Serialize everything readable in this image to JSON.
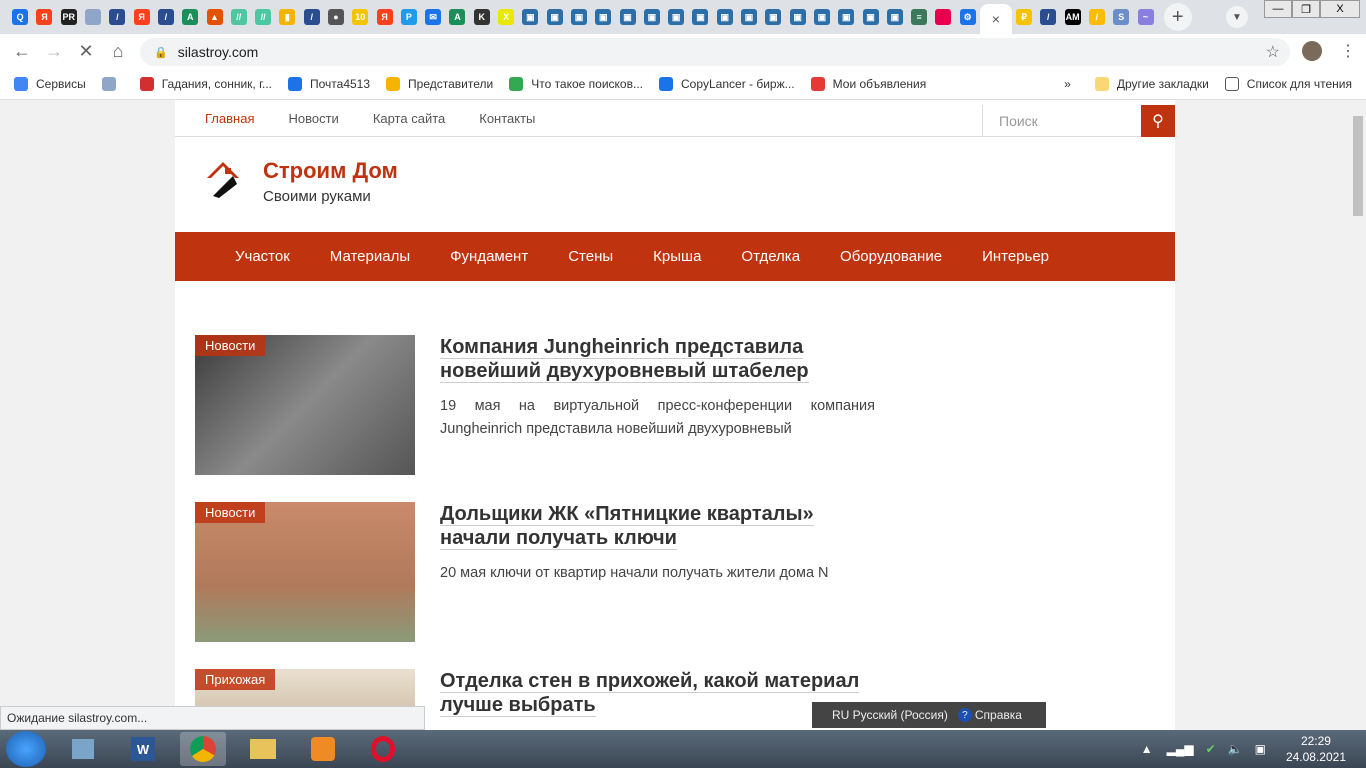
{
  "browser": {
    "tabs": [
      {
        "icon": "search-icon",
        "color": "#1a73e8",
        "glyph": "Q"
      },
      {
        "icon": "yandex-icon",
        "color": "#fc3f1d",
        "glyph": "Я"
      },
      {
        "icon": "pr-icon",
        "color": "#222",
        "glyph": "PR"
      },
      {
        "icon": "blocks-icon",
        "color": "#8fa6c9",
        "glyph": ""
      },
      {
        "icon": "stripes-icon",
        "color": "#2a4d8f",
        "glyph": "/"
      },
      {
        "icon": "yandex-icon",
        "color": "#fc3f1d",
        "glyph": "Я"
      },
      {
        "icon": "stripes-icon",
        "color": "#2a4d8f",
        "glyph": "/"
      },
      {
        "icon": "a-icon",
        "color": "#1b8e5a",
        "glyph": "A"
      },
      {
        "icon": "triangle-icon",
        "color": "#e65100",
        "glyph": "▲"
      },
      {
        "icon": "slash-icon",
        "color": "#4dc7a0",
        "glyph": "//"
      },
      {
        "icon": "slash-icon",
        "color": "#4dc7a0",
        "glyph": "//"
      },
      {
        "icon": "chart-icon",
        "color": "#f4b400",
        "glyph": "▮"
      },
      {
        "icon": "stripes-icon",
        "color": "#2a4d8f",
        "glyph": "/"
      },
      {
        "icon": "globe-icon",
        "color": "#555",
        "glyph": "●"
      },
      {
        "icon": "ten-icon",
        "color": "#f5c400",
        "glyph": "10"
      },
      {
        "icon": "yandex-icon",
        "color": "#fc3f1d",
        "glyph": "Я"
      },
      {
        "icon": "p-icon",
        "color": "#1e9be9",
        "glyph": "P"
      },
      {
        "icon": "mail-icon",
        "color": "#1a73e8",
        "glyph": "✉"
      },
      {
        "icon": "a-icon",
        "color": "#1b8e5a",
        "glyph": "A"
      },
      {
        "icon": "k-icon",
        "color": "#333",
        "glyph": "K"
      },
      {
        "icon": "x-icon",
        "color": "#e8e800",
        "glyph": "X"
      },
      {
        "icon": "monitor-icon",
        "color": "#2b6ea8",
        "glyph": "▣"
      },
      {
        "icon": "monitor-icon",
        "color": "#2b6ea8",
        "glyph": "▣"
      },
      {
        "icon": "monitor-icon",
        "color": "#2b6ea8",
        "glyph": "▣"
      },
      {
        "icon": "monitor-icon",
        "color": "#2b6ea8",
        "glyph": "▣"
      },
      {
        "icon": "monitor-icon",
        "color": "#2b6ea8",
        "glyph": "▣"
      },
      {
        "icon": "monitor-icon",
        "color": "#2b6ea8",
        "glyph": "▣"
      },
      {
        "icon": "monitor-icon",
        "color": "#2b6ea8",
        "glyph": "▣"
      },
      {
        "icon": "monitor-icon",
        "color": "#2b6ea8",
        "glyph": "▣"
      },
      {
        "icon": "monitor-icon",
        "color": "#2b6ea8",
        "glyph": "▣"
      },
      {
        "icon": "monitor-icon",
        "color": "#2b6ea8",
        "glyph": "▣"
      },
      {
        "icon": "monitor-icon",
        "color": "#2b6ea8",
        "glyph": "▣"
      },
      {
        "icon": "monitor-icon",
        "color": "#2b6ea8",
        "glyph": "▣"
      },
      {
        "icon": "monitor-icon",
        "color": "#2b6ea8",
        "glyph": "▣"
      },
      {
        "icon": "monitor-icon",
        "color": "#2b6ea8",
        "glyph": "▣"
      },
      {
        "icon": "monitor-icon",
        "color": "#2b6ea8",
        "glyph": "▣"
      },
      {
        "icon": "monitor-icon",
        "color": "#2b6ea8",
        "glyph": "▣"
      },
      {
        "icon": "bars-icon",
        "color": "#3a7a5a",
        "glyph": "≡"
      },
      {
        "icon": "pentagon-icon",
        "color": "#e8004f",
        "glyph": ""
      },
      {
        "icon": "gear-icon",
        "color": "#1a73e8",
        "glyph": "⚙"
      }
    ],
    "tabs_after": [
      {
        "icon": "ruble-icon",
        "color": "#f5c400",
        "glyph": "₽"
      },
      {
        "icon": "stripes-icon",
        "color": "#2a4d8f",
        "glyph": "/"
      },
      {
        "icon": "am-icon",
        "color": "#000",
        "glyph": "AM"
      },
      {
        "icon": "ads-icon",
        "color": "#fbbc04",
        "glyph": "/"
      },
      {
        "icon": "link-icon",
        "color": "#6b8ec7",
        "glyph": "S"
      },
      {
        "icon": "trend-icon",
        "color": "#8a7ee0",
        "glyph": "~"
      }
    ],
    "active_tab_close": "×",
    "url": "silastroy.com",
    "bookmarks": [
      {
        "label": "Сервисы",
        "color": "#4285f4"
      },
      {
        "label": "",
        "color": "#8fa6c9"
      },
      {
        "label": "Гадания, сонник, г...",
        "color": "#d32f2f"
      },
      {
        "label": "Почта4513",
        "color": "#1a73e8"
      },
      {
        "label": "Представители",
        "color": "#f4b400"
      },
      {
        "label": "Что такое поисков...",
        "color": "#34a853"
      },
      {
        "label": "CopyLancer - бирж...",
        "color": "#1a73e8"
      },
      {
        "label": "Мои объявления",
        "color": "#e53935"
      }
    ],
    "bookmarks_more": "»",
    "other_bookmarks": "Другие закладки",
    "reading_list": "Список для чтения",
    "status": "Ожидание silastroy.com..."
  },
  "site": {
    "topnav": [
      "Главная",
      "Новости",
      "Карта сайта",
      "Контакты"
    ],
    "search_placeholder": "Поиск",
    "title": "Строим Дом",
    "subtitle": "Своими руками",
    "menu": [
      "Участок",
      "Материалы",
      "Фундамент",
      "Стены",
      "Крыша",
      "Отделка",
      "Оборудование",
      "Интерьер"
    ],
    "articles": [
      {
        "category": "Новости",
        "title": "Компания Jungheinrich представила новейший двухуровневый штабелер",
        "excerpt": "19 мая  на виртуальной пресс-конференции компания Jungheinrich представила новейший двухуровневый"
      },
      {
        "category": "Новости",
        "title": "Дольщики ЖК «Пятницкие кварталы» начали получать ключи",
        "excerpt": "20 мая ключи от квартир начали получать жители дома N"
      },
      {
        "category": "Прихожая",
        "title": "Отделка стен в прихожей, какой материал лучше выбрать",
        "excerpt": ""
      }
    ],
    "accent": "#c0330f"
  },
  "os": {
    "language": "RU Русский (Россия)",
    "help": "Справка",
    "time": "22:29",
    "date": "24.08.2021"
  }
}
